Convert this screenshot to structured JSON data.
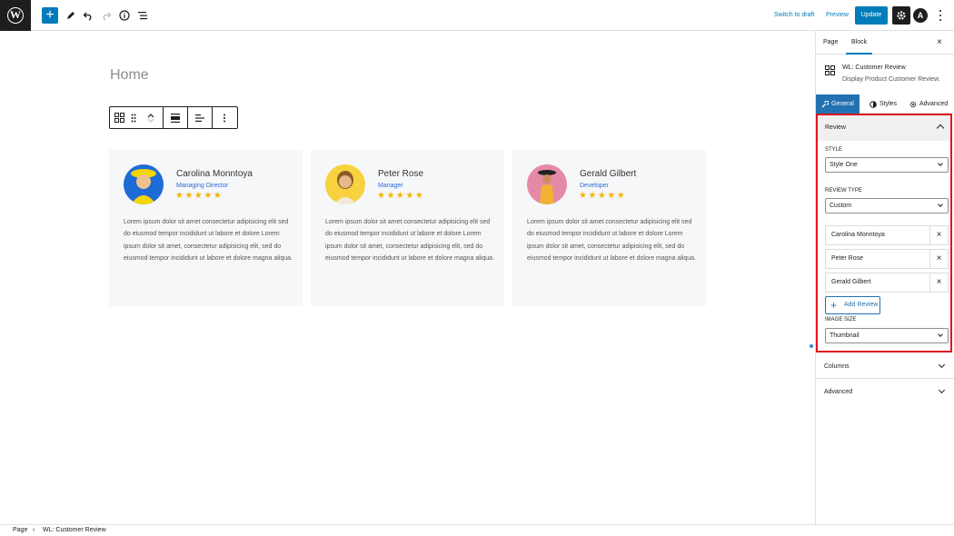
{
  "topbar": {
    "switch_to_draft": "Switch to draft",
    "preview": "Preview",
    "update": "Update",
    "add_symbol": "+",
    "wp_letter": "W",
    "astra_letter": "A"
  },
  "canvas": {
    "title": "Home",
    "reviews": [
      {
        "name": "Carolina Monntoya",
        "role": "Managing Director",
        "stars": "★★★★★",
        "text": "Lorem ipsum dolor sit amet consectetur adipisicing elit sed do eiusmod tempor incididunt ut labore et dolore Lorem ipsum dolor sit amet, consectetur adipisicing elit, sed do eiusmod tempor incididunt ut labore et dolore magna aliqua.",
        "avatar_bg": "#1d6bd6",
        "avatar_fg": "#f5d400"
      },
      {
        "name": "Peter Rose",
        "role": "Manager",
        "stars": "★★★★★",
        "text": "Lorem ipsum dolor sit amet consectetur adipisicing elit sed do eiusmod tempor incididunt ut labore et dolore Lorem ipsum dolor sit amet, consectetur adipisicing elit, sed do eiusmod tempor incididunt ut labore et dolore magna aliqua.",
        "avatar_bg": "#f7d23e",
        "avatar_fg": "#e6b98a"
      },
      {
        "name": "Gerald Gilbert",
        "role": "Developer",
        "stars": "★★★★★",
        "text": "Lorem ipsum dolor sit amet consectetur adipisicing elit sed do eiusmod tempor incididunt ut labore et dolore Lorem ipsum dolor sit amet, consectetur adipisicing elit, sed do eiusmod tempor incididunt ut labore et dolore magna aliqua.",
        "avatar_bg": "#e58aa6",
        "avatar_fg": "#f2b233"
      }
    ]
  },
  "sidebar": {
    "tab_page": "Page",
    "tab_block": "Block",
    "close": "×",
    "block_title": "WL: Customer Review",
    "block_desc": "Display Product Customer Review.",
    "mode_general": "General",
    "mode_styles": "Styles",
    "mode_advanced": "Advanced",
    "review_panel": {
      "title": "Review",
      "style_label": "STYLE",
      "style_value": "Style One",
      "review_type_label": "REVIEW TYPE",
      "review_type_value": "Custom",
      "items": [
        "Carolina Monntoya",
        "Peter Rose",
        "Gerald Gilbert"
      ],
      "add_review": "Add Review",
      "image_size_label": "IMAGE SIZE",
      "image_size_value": "Thumbnail"
    },
    "columns_panel": "Columns",
    "advanced_panel": "Advanced"
  },
  "footer": {
    "crumb_page": "Page",
    "crumb_sep": "›",
    "crumb_block": "WL: Customer Review"
  },
  "colors": {
    "accent": "#007cba",
    "highlight_border": "#e0161b",
    "stars": "#f7b500"
  }
}
